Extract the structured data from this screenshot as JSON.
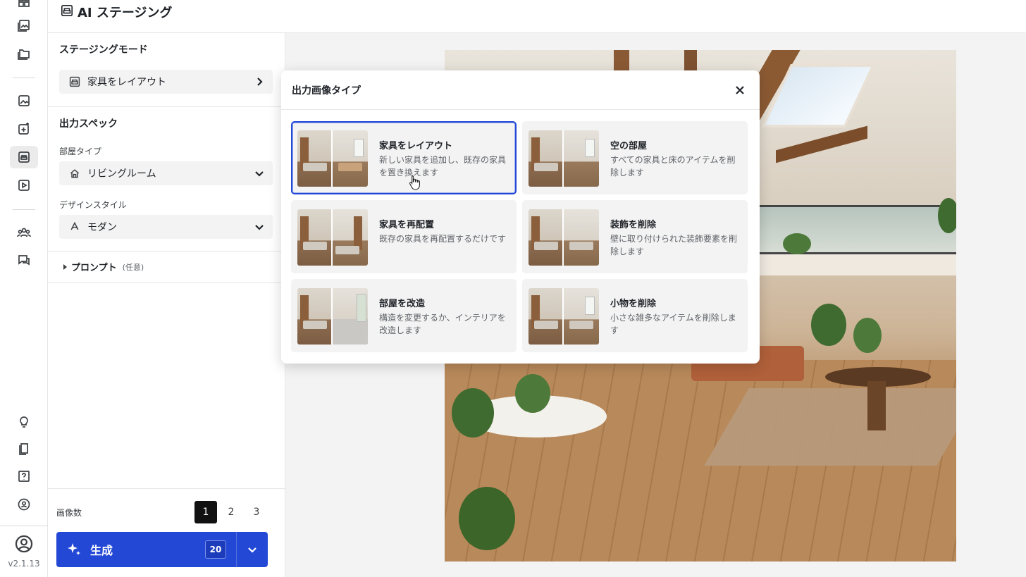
{
  "header": {
    "title": "AI ステージング"
  },
  "rail": {
    "items": [
      {
        "name": "grid-icon"
      },
      {
        "name": "gallery-icon"
      },
      {
        "name": "folder-icon"
      },
      {
        "name": "image-icon"
      },
      {
        "name": "image-plus-icon"
      },
      {
        "name": "staging-icon",
        "active": true
      },
      {
        "name": "video-icon"
      },
      {
        "name": "team-icon"
      },
      {
        "name": "chat-icon"
      },
      {
        "name": "lightbulb-icon"
      },
      {
        "name": "book-icon"
      },
      {
        "name": "help-icon"
      },
      {
        "name": "account-badge-icon"
      },
      {
        "name": "profile-icon"
      }
    ],
    "version": "v2.1.13"
  },
  "panel": {
    "staging_mode_title": "ステージングモード",
    "staging_mode_value": "家具をレイアウト",
    "output_spec_title": "出力スペック",
    "room_type_label": "部屋タイプ",
    "room_type_value": "リビングルーム",
    "design_style_label": "デザインスタイル",
    "design_style_value": "モダン",
    "prompt_label": "プロンプト",
    "prompt_optional": "(任意)",
    "image_count_label": "画像数",
    "image_count_options": [
      "1",
      "2",
      "3"
    ],
    "image_count_selected": "1",
    "generate_label": "生成",
    "generate_credits": "20",
    "accent_color": "#2348d6"
  },
  "modal": {
    "title": "出力画像タイプ",
    "options": [
      {
        "title": "家具をレイアウト",
        "desc": "新しい家具を追加し、既存の家具を置き換えます",
        "selected": true
      },
      {
        "title": "空の部屋",
        "desc": "すべての家具と床のアイテムを削除します",
        "selected": false
      },
      {
        "title": "家具を再配置",
        "desc": "既存の家具を再配置するだけです",
        "selected": false
      },
      {
        "title": "装飾を削除",
        "desc": "壁に取り付けられた装飾要素を削除します",
        "selected": false
      },
      {
        "title": "部屋を改造",
        "desc": "構造を変更するか、インテリアを改造します",
        "selected": false
      },
      {
        "title": "小物を削除",
        "desc": "小さな雑多なアイテムを削除します",
        "selected": false
      }
    ]
  }
}
